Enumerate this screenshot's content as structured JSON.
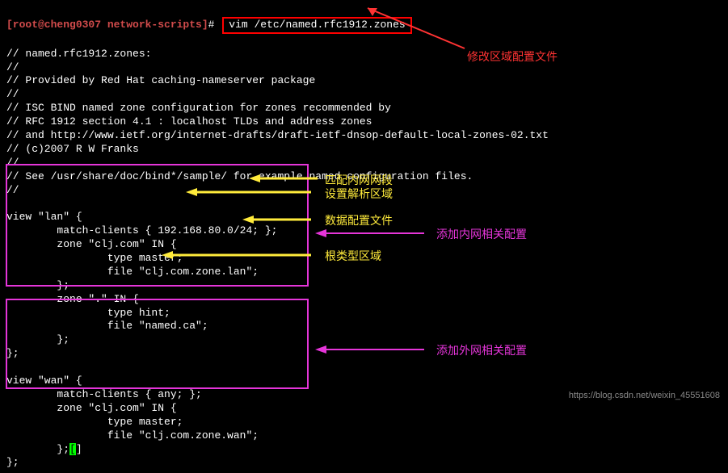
{
  "prompt": {
    "user_host": "[root@cheng0307 network-scripts]",
    "hash": "#",
    "command": "vim /etc/named.rfc1912.zones"
  },
  "comments": {
    "line1": "// named.rfc1912.zones:",
    "line2": "//",
    "line3": "// Provided by Red Hat caching-nameserver package",
    "line4": "//",
    "line5": "// ISC BIND named zone configuration for zones recommended by",
    "line6": "// RFC 1912 section 4.1 : localhost TLDs and address zones",
    "line7": "// and http://www.ietf.org/internet-drafts/draft-ietf-dnsop-default-local-zones-02.txt",
    "line8": "// (c)2007 R W Franks",
    "line9": "//",
    "line10": "// See /usr/share/doc/bind*/sample/ for example named configuration files.",
    "line11": "//"
  },
  "view_lan": {
    "open": "view \"lan\" {",
    "match": "        match-clients { 192.168.80.0/24; };",
    "zone1_open": "        zone \"clj.com\" IN {",
    "zone1_type": "                type master;",
    "zone1_file": "                file \"clj.com.zone.lan\";",
    "zone1_close": "        };",
    "zone2_open": "        zone \".\" IN {",
    "zone2_type": "                type hint;",
    "zone2_file": "                file \"named.ca\";",
    "zone2_close": "        };",
    "close": "};"
  },
  "view_wan": {
    "open": "view \"wan\" {",
    "match": "        match-clients { any; };",
    "zone1_open": "        zone \"clj.com\" IN {",
    "zone1_type": "                type master;",
    "zone1_file": "                file \"clj.com.zone.wan\";",
    "zone1_close": "        };",
    "close": "};"
  },
  "annotations": {
    "modify_zone": "修改区域配置文件",
    "match_intranet": "匹配内网网段",
    "set_resolve": "设置解析区域",
    "data_config": "数据配置文件",
    "root_zone": "根类型区域",
    "add_intranet": "添加内网相关配置",
    "add_extranet": "添加外网相关配置"
  },
  "watermark": "https://blog.csdn.net/weixin_45551608"
}
